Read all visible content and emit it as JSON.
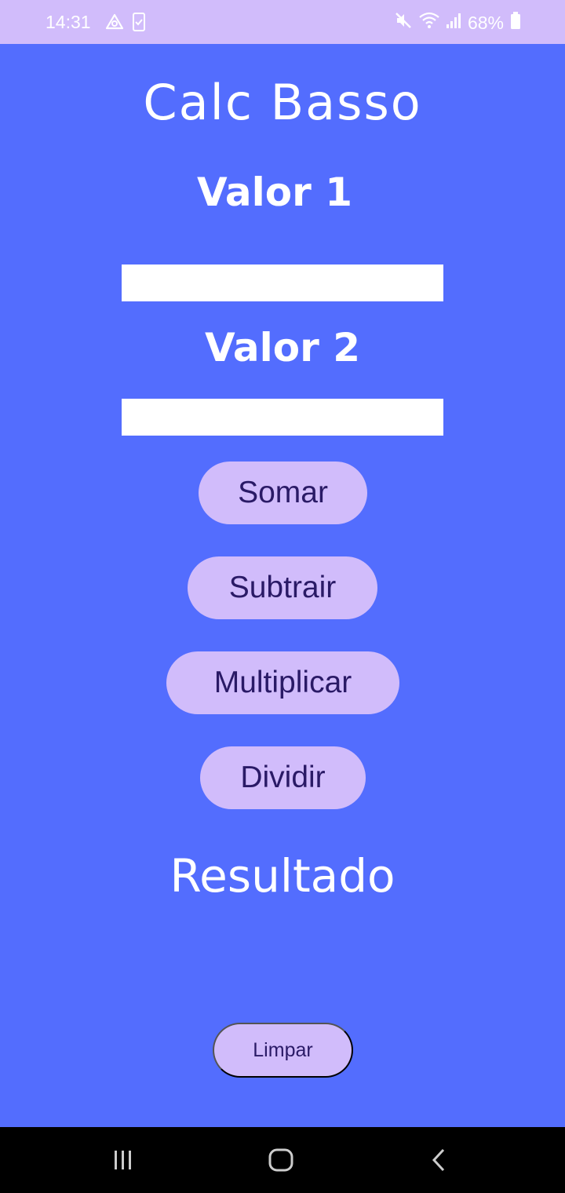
{
  "status_bar": {
    "time": "14:31",
    "battery": "68%",
    "icons": [
      "navigation-app-icon",
      "phone-check-icon",
      "mute-icon",
      "wifi-icon",
      "signal-icon",
      "battery-icon"
    ]
  },
  "app": {
    "title": "Calc Basso",
    "value1_label": "Valor 1",
    "value1_input": "",
    "value2_label": "Valor 2",
    "value2_input": "",
    "buttons": {
      "add": "Somar",
      "subtract": "Subtrair",
      "multiply": "Multiplicar",
      "divide": "Dividir",
      "clear": "Limpar"
    },
    "result": "Resultado",
    "colors": {
      "background": "#536DFE",
      "button": "#D1BCFB",
      "button_text": "#2A1A66",
      "status_bar": "#D1BCFB"
    }
  },
  "nav_bar": {
    "icons": [
      "recent-apps-icon",
      "home-icon",
      "back-icon"
    ]
  }
}
